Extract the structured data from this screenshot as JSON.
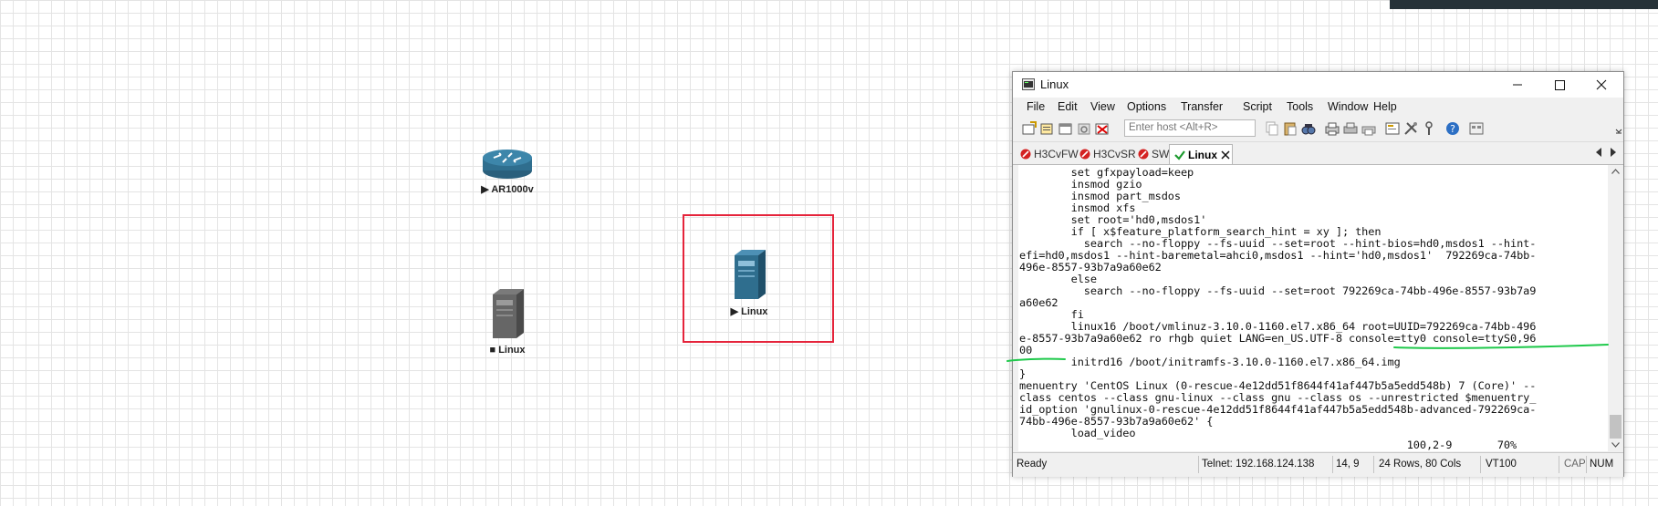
{
  "canvas": {
    "nodes": [
      {
        "label": "AR1000v",
        "state": "running",
        "icon": "router-icon"
      },
      {
        "label": "Linux",
        "state": "stopped",
        "icon": "server-icon"
      },
      {
        "label": "Linux",
        "state": "running",
        "icon": "server-icon",
        "selected": true
      }
    ]
  },
  "window": {
    "title": "Linux",
    "menu": [
      "File",
      "Edit",
      "View",
      "Options",
      "Transfer",
      "Script",
      "Tools",
      "Window",
      "Help"
    ],
    "host_placeholder": "Enter host <Alt+R>",
    "tabs": [
      {
        "label": "H3CvFW",
        "status": "disconnected"
      },
      {
        "label": "H3CvSR",
        "status": "disconnected"
      },
      {
        "label": "SW",
        "status": "disconnected"
      },
      {
        "label": "Linux",
        "status": "connected",
        "active": true
      }
    ],
    "terminal_lines": [
      "        set gfxpayload=keep",
      "        insmod gzio",
      "        insmod part_msdos",
      "        insmod xfs",
      "        set root='hd0,msdos1'",
      "        if [ x$feature_platform_search_hint = xy ]; then",
      "          search --no-floppy --fs-uuid --set=root --hint-bios=hd0,msdos1 --hint-",
      "efi=hd0,msdos1 --hint-baremetal=ahci0,msdos1 --hint='hd0,msdos1'  792269ca-74bb-",
      "496e-8557-93b7a9a60e62",
      "        else",
      "          search --no-floppy --fs-uuid --set=root 792269ca-74bb-496e-8557-93b7a9",
      "a60e62",
      "        fi",
      "        linux16 /boot/vmlinuz-3.10.0-1160.el7.x86_64 root=UUID=792269ca-74bb-496",
      "e-8557-93b7a9a60e62 ro rhgb quiet LANG=en_US.UTF-8 console=tty0 console=ttyS0,96",
      "00",
      "        initrd16 /boot/initramfs-3.10.0-1160.el7.x86_64.img",
      "}",
      "menuentry 'CentOS Linux (0-rescue-4e12dd51f8644f41af447b5a5edd548b) 7 (Core)' --",
      "class centos --class gnu-linux --class gnu --class os --unrestricted $menuentry_",
      "id_option 'gnulinux-0-rescue-4e12dd51f8644f41af447b5a5edd548b-advanced-792269ca-",
      "74bb-496e-8557-93b7a9a60e62' {",
      "        load_video",
      "                                                            100,2-9       70%"
    ],
    "status": {
      "ready": "Ready",
      "connection": "Telnet: 192.168.124.138",
      "cursor": "14,  9",
      "size": "24 Rows, 80 Cols",
      "emulation": "VT100",
      "cap": "CAP",
      "num": "NUM"
    },
    "scroll_position": 0.93
  },
  "colors": {
    "selection": "#e5243b",
    "annotation": "#1fc94b",
    "device": "#2f6e8e"
  }
}
